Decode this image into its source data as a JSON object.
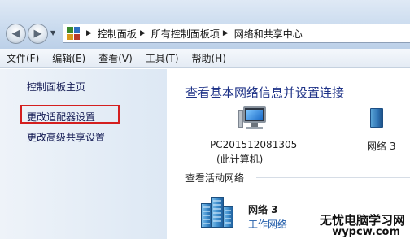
{
  "address_bar": {
    "crumbs": [
      "控制面板",
      "所有控制面板项",
      "网络和共享中心"
    ]
  },
  "menu": [
    "文件(F)",
    "编辑(E)",
    "查看(V)",
    "工具(T)",
    "帮助(H)"
  ],
  "sidebar": {
    "home": "控制面板主页",
    "adapter_settings": "更改适配器设置",
    "advanced_sharing": "更改高级共享设置",
    "highlight_color": "#d41f1f"
  },
  "main": {
    "title": "查看基本网络信息并设置连接",
    "computer_name": "PC201512081305",
    "computer_sub": "(此计算机)",
    "network_short": "网络  3",
    "active_networks_title": "查看活动网络",
    "active_network_name": "网络  3",
    "active_network_type": "工作网络"
  },
  "watermark": {
    "line1": "无忧电脑学习网",
    "line2": "wypcw.com"
  },
  "colors": {
    "title": "#1e3287",
    "link": "#151c55",
    "network_type": "#1e5aa8"
  }
}
